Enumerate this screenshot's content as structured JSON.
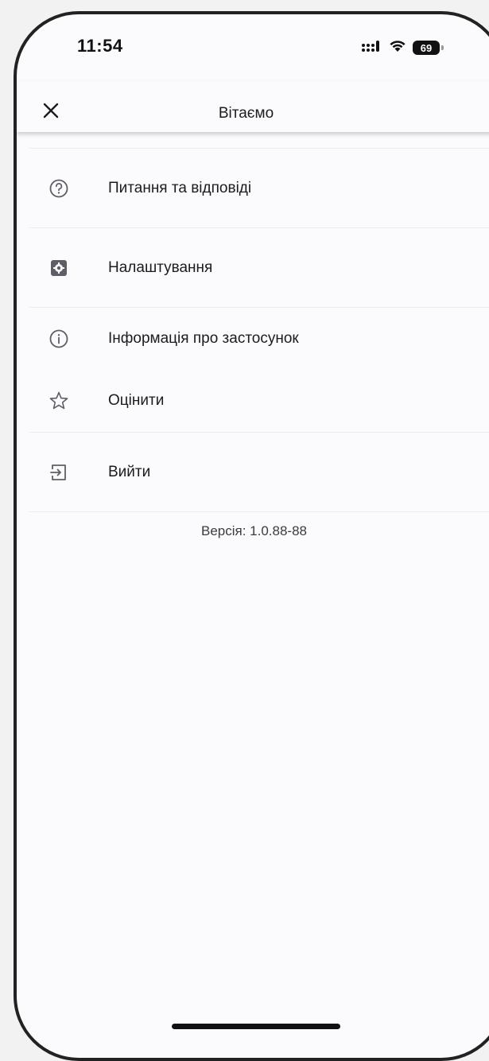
{
  "status_bar": {
    "time": "11:54",
    "battery": "69"
  },
  "header": {
    "title": "Вітаємо",
    "close_icon": "close-icon"
  },
  "menu": {
    "items": [
      {
        "label": "Питання та відповіді",
        "icon": "help-circle-icon"
      },
      {
        "label": "Налаштування",
        "icon": "settings-gear-icon"
      },
      {
        "label": "Інформація про застосунок",
        "icon": "info-circle-icon"
      },
      {
        "label": "Оцінити",
        "icon": "star-outline-icon"
      },
      {
        "label": "Вийти",
        "icon": "logout-icon"
      }
    ]
  },
  "footer": {
    "version": "Версія: 1.0.88-88"
  },
  "colors": {
    "background": "#fbfafd",
    "text": "#1c1b1f",
    "icon": "#5f5e66",
    "divider": "#ecebef"
  }
}
